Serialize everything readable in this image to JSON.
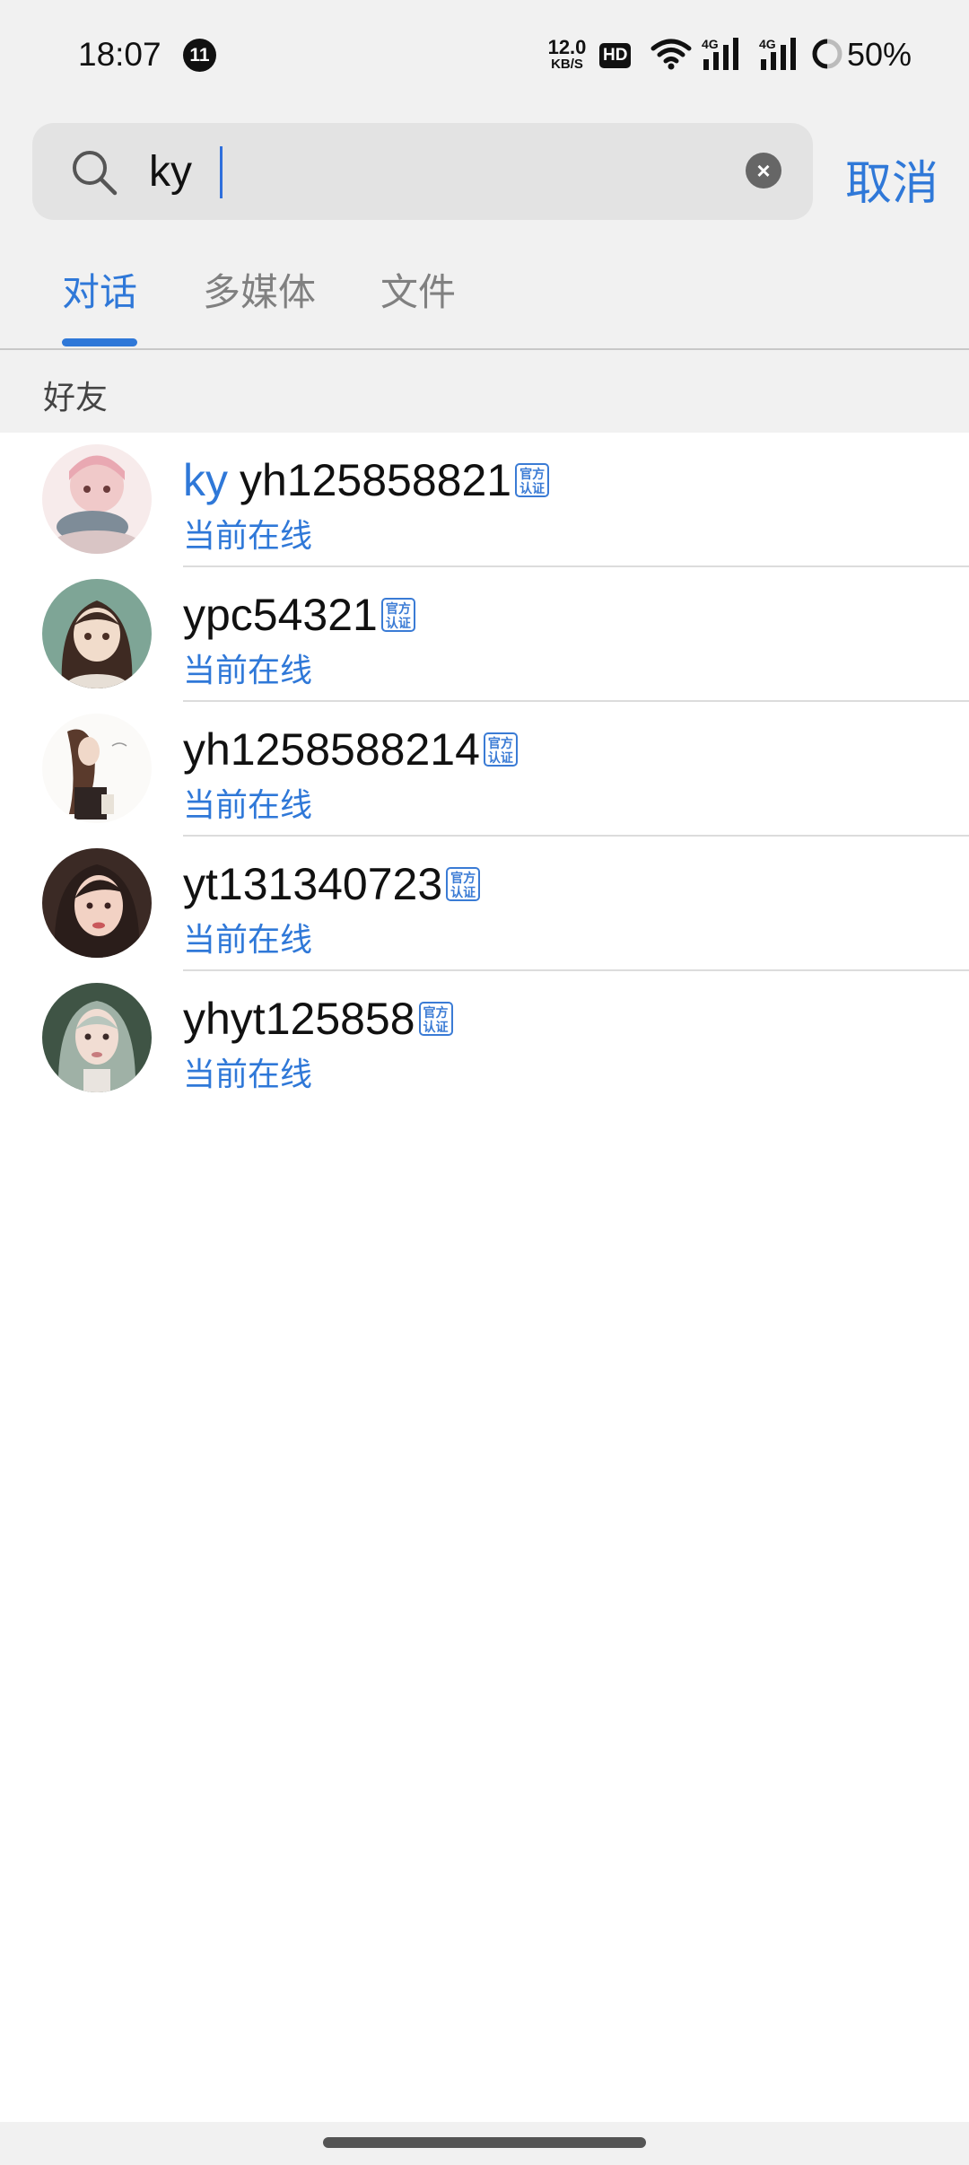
{
  "status_bar": {
    "time": "18:07",
    "notification_count": "11",
    "speed_value": "12.0",
    "speed_unit": "KB/S",
    "hd_label": "HD",
    "signal_label_1": "4G",
    "signal_label_2": "4G",
    "battery": "50%"
  },
  "search": {
    "query": "ky",
    "cancel_label": "取消"
  },
  "tabs": [
    {
      "label": "对话",
      "active": true
    },
    {
      "label": "多媒体",
      "active": false
    },
    {
      "label": "文件",
      "active": false
    }
  ],
  "section_title": "好友",
  "badge_text": "官方认证",
  "results": [
    {
      "highlight": "ky",
      "name": "yh125858821",
      "status": "当前在线"
    },
    {
      "highlight": "",
      "name": "ypc54321",
      "status": "当前在线"
    },
    {
      "highlight": "",
      "name": "yh1258588214",
      "status": "当前在线"
    },
    {
      "highlight": "",
      "name": "yt131340723",
      "status": "当前在线"
    },
    {
      "highlight": "",
      "name": "yhyt125858",
      "status": "当前在线"
    }
  ],
  "colors": {
    "accent": "#2f78d8",
    "background_top": "#f1f1f1",
    "text_primary": "#111111"
  }
}
